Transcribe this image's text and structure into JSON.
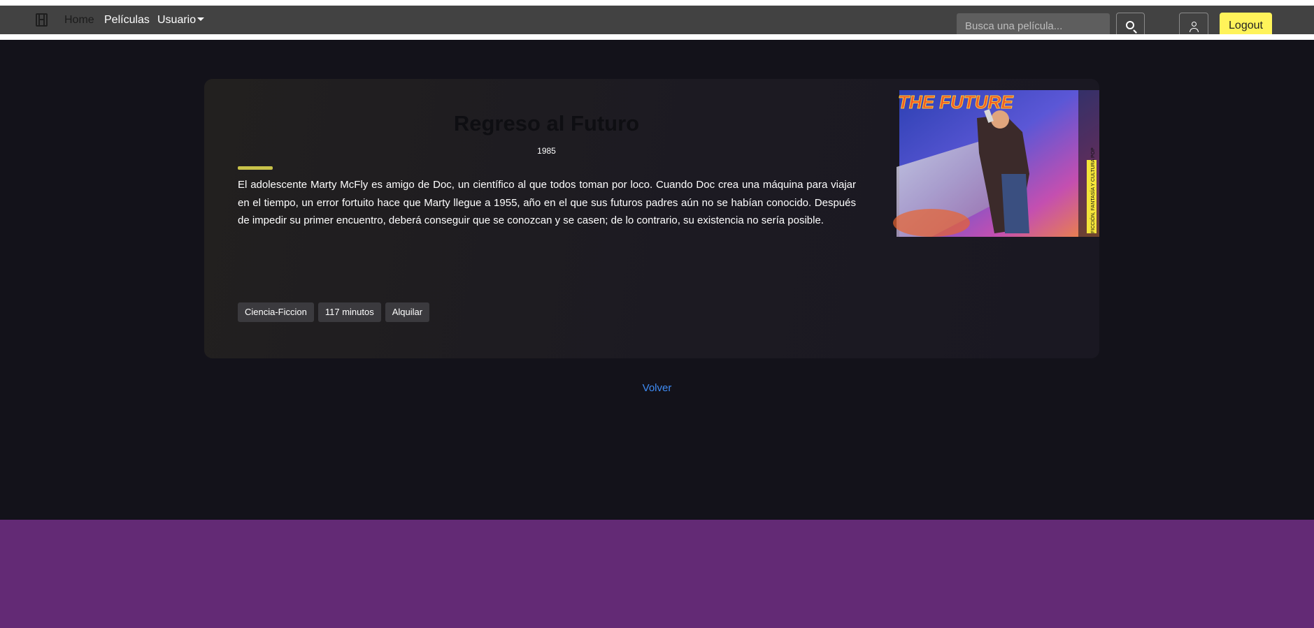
{
  "nav": {
    "home": "Home",
    "peliculas": "Películas",
    "usuario": "Usuario",
    "search_placeholder": "Busca una película...",
    "logout": "Logout"
  },
  "movie": {
    "title": "Regreso al Futuro",
    "year": "1985",
    "synopsis": "El adolescente Marty McFly es amigo de Doc, un científico al que todos toman por loco. Cuando Doc crea una máquina para viajar en el tiempo, un error fortuito hace que Marty llegue a 1955, año en el que sus futuros padres aún no se habían conocido. Después de impedir su primer encuentro, deberá conseguir que se conozcan y se casen; de lo contrario, su existencia no sería posible.",
    "genre": "Ciencia-Ficcion",
    "duration": "117 minutos",
    "rent": "Alquilar",
    "poster": {
      "headline": "THE FUTURE",
      "side_text": "FICCIÓN, FANTASÍA Y CULTURA POP"
    }
  },
  "back_link": "Volver",
  "colors": {
    "navbar": "#424242",
    "background": "#13121a",
    "accent": "#c8c24a",
    "logout_button": "#fff35a",
    "link": "#3f8cf5",
    "footer": "#632a75"
  }
}
